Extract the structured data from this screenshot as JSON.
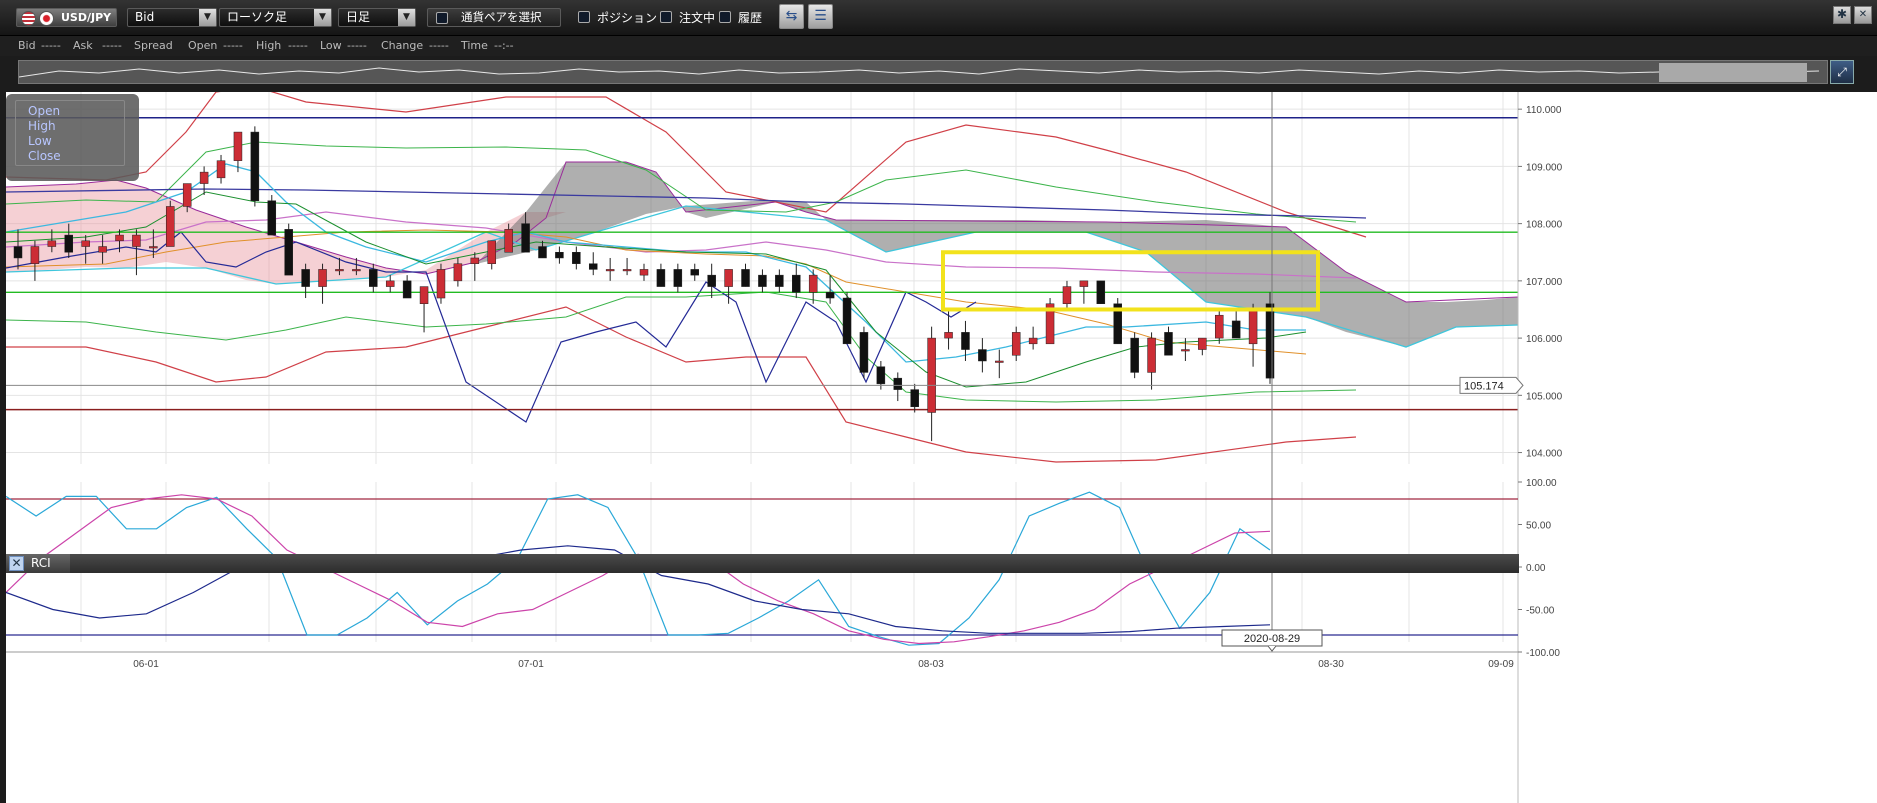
{
  "toolbar": {
    "pair": "USD/JPY",
    "price_type": "Bid",
    "chart_type": "ローソク足",
    "timeframe": "日足",
    "select_pair_label": "通貨ペアを選択",
    "position_label": "ポジション",
    "orders_label": "注文中",
    "history_label": "履歴"
  },
  "quote_bar": {
    "bid_label": "Bid",
    "bid_value": "-----",
    "ask_label": "Ask",
    "ask_value": "-----",
    "spread_label": "Spread",
    "open_label": "Open",
    "open_value": "-----",
    "high_label": "High",
    "high_value": "-----",
    "low_label": "Low",
    "low_value": "-----",
    "change_label": "Change",
    "change_value": "-----",
    "time_label": "Time",
    "time_value": "--:--"
  },
  "ohlc_box": {
    "open": "Open",
    "high": "High",
    "low": "Low",
    "close": "Close"
  },
  "rci_label": "RCI",
  "chart_data": [
    {
      "type": "candlestick",
      "pair": "USD/JPY",
      "timeframe": "daily",
      "ylim": [
        103.8,
        110.3
      ],
      "yticks": [
        "110.000",
        "109.000",
        "108.000",
        "107.000",
        "106.000",
        "105.000",
        "104.000"
      ],
      "xtick_labels": [
        "06-01",
        "07-01",
        "08-03",
        "08-30",
        "09-09"
      ],
      "current_price": "105.174",
      "crosshair_date": "2020-08-29",
      "candles": [
        [
          107.6,
          107.9,
          107.2,
          107.4
        ],
        [
          107.3,
          107.7,
          107.0,
          107.6
        ],
        [
          107.6,
          107.9,
          107.5,
          107.7
        ],
        [
          107.8,
          108.0,
          107.4,
          107.5
        ],
        [
          107.6,
          107.8,
          107.3,
          107.7
        ],
        [
          107.5,
          107.8,
          107.3,
          107.6
        ],
        [
          107.7,
          107.9,
          107.5,
          107.8
        ],
        [
          107.6,
          107.9,
          107.1,
          107.8
        ],
        [
          107.6,
          107.9,
          107.4,
          107.6
        ],
        [
          107.6,
          108.4,
          107.6,
          108.3
        ],
        [
          108.3,
          108.7,
          108.2,
          108.7
        ],
        [
          108.7,
          109.0,
          108.5,
          108.9
        ],
        [
          108.8,
          109.2,
          108.7,
          109.1
        ],
        [
          109.1,
          109.6,
          108.9,
          109.6
        ],
        [
          109.6,
          109.7,
          108.3,
          108.4
        ],
        [
          108.4,
          108.5,
          107.9,
          107.8
        ],
        [
          107.9,
          108.0,
          107.2,
          107.1
        ],
        [
          107.2,
          107.3,
          106.7,
          106.9
        ],
        [
          106.9,
          107.3,
          106.6,
          107.2
        ],
        [
          107.2,
          107.4,
          107.1,
          107.2
        ],
        [
          107.2,
          107.4,
          107.1,
          107.2
        ],
        [
          107.2,
          107.3,
          106.8,
          106.9
        ],
        [
          106.9,
          107.1,
          106.8,
          107.0
        ],
        [
          107.0,
          107.1,
          106.8,
          106.7
        ],
        [
          106.6,
          106.9,
          106.1,
          106.9
        ],
        [
          106.7,
          107.3,
          106.6,
          107.2
        ],
        [
          107.0,
          107.4,
          106.9,
          107.3
        ],
        [
          107.3,
          107.5,
          107.0,
          107.4
        ],
        [
          107.3,
          107.7,
          107.2,
          107.7
        ],
        [
          107.5,
          108.0,
          107.5,
          107.9
        ],
        [
          108.0,
          108.2,
          107.5,
          107.5
        ],
        [
          107.6,
          107.7,
          107.4,
          107.4
        ],
        [
          107.5,
          107.6,
          107.3,
          107.4
        ],
        [
          107.5,
          107.6,
          107.2,
          107.3
        ],
        [
          107.3,
          107.5,
          107.1,
          107.2
        ],
        [
          107.2,
          107.4,
          107.0,
          107.2
        ],
        [
          107.2,
          107.4,
          107.1,
          107.2
        ],
        [
          107.1,
          107.3,
          107.0,
          107.2
        ],
        [
          107.2,
          107.3,
          106.9,
          106.9
        ],
        [
          107.2,
          107.3,
          106.8,
          106.9
        ],
        [
          107.2,
          107.3,
          107.0,
          107.1
        ],
        [
          107.1,
          107.3,
          106.7,
          106.9
        ],
        [
          106.9,
          107.1,
          106.6,
          107.2
        ],
        [
          107.2,
          107.3,
          106.9,
          106.9
        ],
        [
          107.1,
          107.2,
          106.8,
          106.9
        ],
        [
          107.1,
          107.2,
          106.8,
          106.9
        ],
        [
          107.1,
          107.3,
          106.7,
          106.8
        ],
        [
          106.8,
          107.2,
          106.6,
          107.1
        ],
        [
          106.8,
          107.1,
          106.6,
          106.7
        ],
        [
          106.7,
          106.8,
          105.9,
          105.9
        ],
        [
          106.1,
          106.2,
          105.3,
          105.4
        ],
        [
          105.5,
          105.6,
          105.1,
          105.2
        ],
        [
          105.3,
          105.4,
          104.9,
          105.1
        ],
        [
          105.1,
          105.2,
          104.7,
          104.8
        ],
        [
          104.7,
          106.2,
          104.2,
          106.0
        ],
        [
          106.0,
          106.5,
          105.8,
          106.1
        ],
        [
          106.1,
          106.3,
          105.6,
          105.8
        ],
        [
          105.8,
          106.0,
          105.4,
          105.6
        ],
        [
          105.6,
          105.8,
          105.3,
          105.6
        ],
        [
          105.7,
          106.2,
          105.6,
          106.1
        ],
        [
          105.9,
          106.2,
          105.8,
          106.0
        ],
        [
          105.9,
          106.7,
          105.9,
          106.6
        ],
        [
          106.6,
          107.0,
          106.5,
          106.9
        ],
        [
          106.9,
          107.0,
          106.6,
          107.0
        ],
        [
          107.0,
          107.0,
          106.6,
          106.6
        ],
        [
          106.6,
          106.7,
          105.9,
          105.9
        ],
        [
          106.0,
          106.1,
          105.3,
          105.4
        ],
        [
          105.4,
          106.1,
          105.1,
          106.0
        ],
        [
          106.1,
          106.2,
          105.7,
          105.7
        ],
        [
          105.8,
          106.0,
          105.6,
          105.8
        ],
        [
          105.8,
          106.0,
          105.7,
          106.0
        ],
        [
          106.0,
          106.5,
          105.9,
          106.4
        ],
        [
          106.3,
          106.5,
          106.0,
          106.0
        ],
        [
          105.9,
          106.6,
          105.5,
          106.5
        ],
        [
          106.6,
          106.8,
          105.2,
          105.3
        ]
      ],
      "ichimoku_cloud": "shaded area (pink = bullish, gray = bearish)",
      "horizontal_lines": [
        109.85,
        107.85,
        106.8,
        104.75
      ],
      "highlight_box": {
        "y_range": [
          106.5,
          107.5
        ]
      }
    },
    {
      "type": "line",
      "title": "RCI",
      "ylim": [
        -100,
        100
      ],
      "yticks": [
        "100.00",
        "50.00",
        "0.00",
        "-50.00",
        "-100.00"
      ],
      "series": [
        {
          "color": "#2aa8d8",
          "values": [
            83,
            60,
            83,
            83,
            45,
            45,
            70,
            82,
            45,
            10,
            -80,
            -80,
            -60,
            -30,
            -68,
            -40,
            -20,
            10,
            80,
            85,
            70,
            10,
            -80,
            -80,
            -78,
            -60,
            -40,
            -15,
            -70,
            -82,
            -92,
            -90,
            -60,
            -15,
            60,
            75,
            88,
            70,
            -10,
            -72,
            -30,
            45,
            20
          ]
        },
        {
          "color": "#cc44aa",
          "values": [
            -30,
            10,
            40,
            70,
            80,
            85,
            80,
            60,
            20,
            0,
            -20,
            -40,
            -65,
            -70,
            -55,
            -50,
            -30,
            -10,
            15,
            5,
            10,
            -20,
            -40,
            -55,
            -75,
            -85,
            -90,
            -88,
            -82,
            -75,
            -65,
            -50,
            -20,
            0,
            20,
            40,
            42
          ]
        },
        {
          "color": "#1e2a8c",
          "values": [
            -30,
            -50,
            -60,
            -55,
            -30,
            0,
            -5,
            0,
            0,
            5,
            10,
            20,
            25,
            20,
            -10,
            -20,
            -40,
            -50,
            -55,
            -70,
            -75,
            -78,
            -78,
            -78,
            -76,
            -72,
            -70,
            -68
          ]
        }
      ],
      "reference_lines": [
        80,
        0,
        -80
      ]
    }
  ]
}
